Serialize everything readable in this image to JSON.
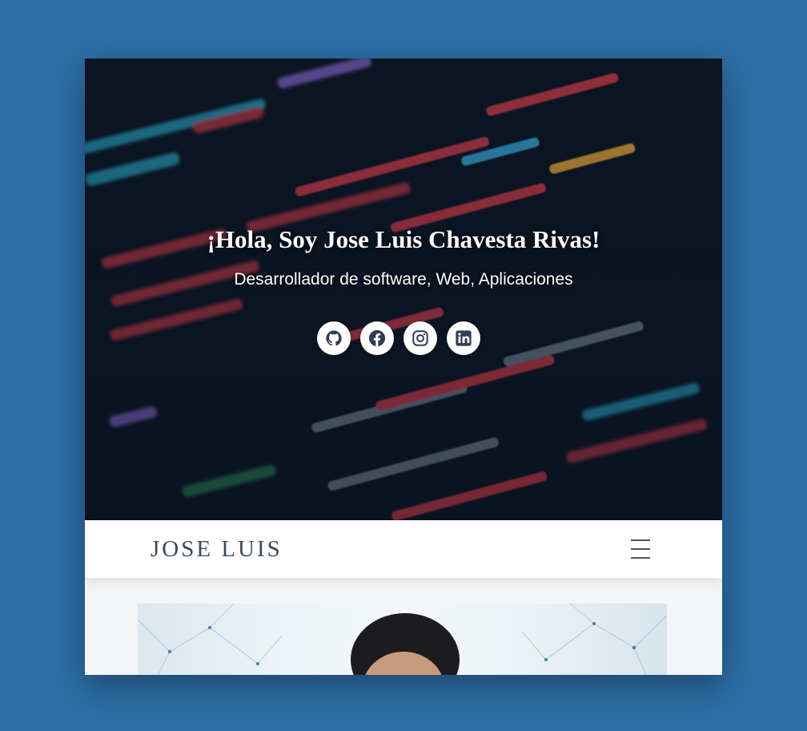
{
  "hero": {
    "title": "¡Hola, Soy Jose Luis Chavesta Rivas!",
    "subtitle": "Desarrollador de software, Web, Aplicaciones"
  },
  "socials": [
    {
      "name": "github",
      "icon": "github-icon"
    },
    {
      "name": "facebook",
      "icon": "facebook-icon"
    },
    {
      "name": "instagram",
      "icon": "instagram-icon"
    },
    {
      "name": "linkedin",
      "icon": "linkedin-icon"
    }
  ],
  "navbar": {
    "brand": "JOSE LUIS",
    "menu_icon": "hamburger-menu-icon"
  },
  "colors": {
    "page_background": "#2d6ea6",
    "hero_background": "#0c1624",
    "brand_text": "#3b4a5e",
    "icon_color": "#2f3e53"
  }
}
